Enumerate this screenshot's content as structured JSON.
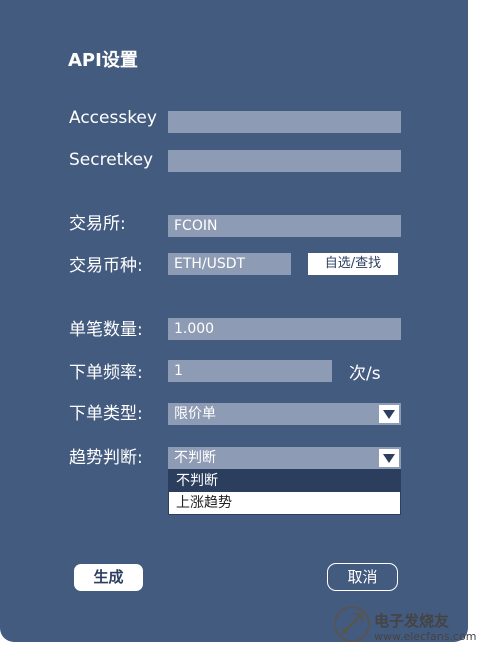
{
  "title": "API设置",
  "fields": {
    "accesskey": {
      "label": "Accesskey",
      "value": ""
    },
    "secretkey": {
      "label": "Secretkey",
      "value": ""
    },
    "exchange": {
      "label": "交易所:",
      "value": "FCOIN"
    },
    "pair": {
      "label": "交易币种:",
      "value": "ETH/USDT",
      "button": "自选/查找"
    },
    "quantity": {
      "label": "单笔数量:",
      "value": "1.000"
    },
    "frequency": {
      "label": "下单频率:",
      "value": "1",
      "unit": "次/s"
    },
    "order_type": {
      "label": "下单类型:",
      "value": "限价单"
    },
    "trend": {
      "label": "趋势判断:",
      "value": "不判断",
      "options": [
        "不判断",
        "上涨趋势"
      ]
    }
  },
  "buttons": {
    "generate": "生成",
    "cancel": "取消"
  },
  "watermark": {
    "brand": "电子发烧友",
    "url": "www.elecfans.com"
  },
  "colors": {
    "panel": "#445b80",
    "input": "#8e9bb4",
    "menu_selected": "#2b3e5e"
  }
}
